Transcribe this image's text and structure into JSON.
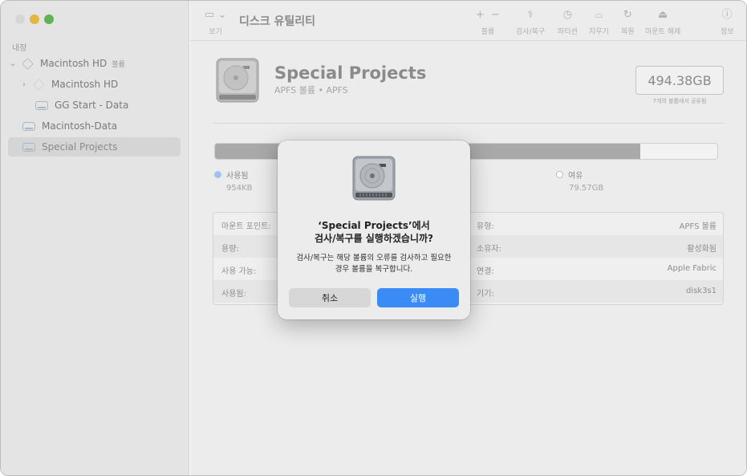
{
  "sidebar": {
    "section_label": "내장",
    "items": [
      {
        "label": "Macintosh HD",
        "badge": "볼륨"
      },
      {
        "label": "Macintosh HD"
      },
      {
        "label": "GG Start - Data"
      },
      {
        "label": "Macintosh-Data"
      },
      {
        "label": "Special Projects"
      }
    ]
  },
  "toolbar": {
    "title": "디스크 유틸리티",
    "view_label": "보기",
    "volume_label": "볼륨",
    "first_aid_label": "검사/복구",
    "partition_label": "파티션",
    "erase_label": "지우기",
    "restore_label": "복원",
    "unmount_label": "마운트 해제",
    "info_label": "정보"
  },
  "volume": {
    "name": "Special Projects",
    "subtitle": "APFS 볼륨 • APFS",
    "capacity": "494.38GB",
    "capacity_note": "7개의 볼륨에서 공유됨",
    "used_fraction": 0.846,
    "used_label": "사용됨",
    "used_value": "954KB",
    "free_label": "여유",
    "free_value": "79.57GB",
    "used_color": "#9cc4ef",
    "free_color": "#ffffff"
  },
  "info": {
    "left": [
      {
        "key": "마운트 포인트:",
        "value": ""
      },
      {
        "key": "용량:",
        "value": ""
      },
      {
        "key": "사용 가능:",
        "value": ""
      },
      {
        "key": "사용됨:",
        "value": ""
      }
    ],
    "right": [
      {
        "key": "유형:",
        "value": "APFS 볼륨"
      },
      {
        "key": "소유자:",
        "value": "활성화됨"
      },
      {
        "key": "연결:",
        "value": "Apple Fabric"
      },
      {
        "key": "기기:",
        "value": "disk3s1"
      }
    ]
  },
  "dialog": {
    "title_line1": "‘Special Projects’에서",
    "title_line2": "검사/복구를 실행하겠습니까?",
    "message_line1": "검사/복구는 해당 볼륨의 오류를 검사하고 필요한",
    "message_line2": "경우 볼륨을 복구합니다.",
    "cancel_label": "취소",
    "run_label": "실행",
    "accent_color": "#3a8bf5"
  }
}
